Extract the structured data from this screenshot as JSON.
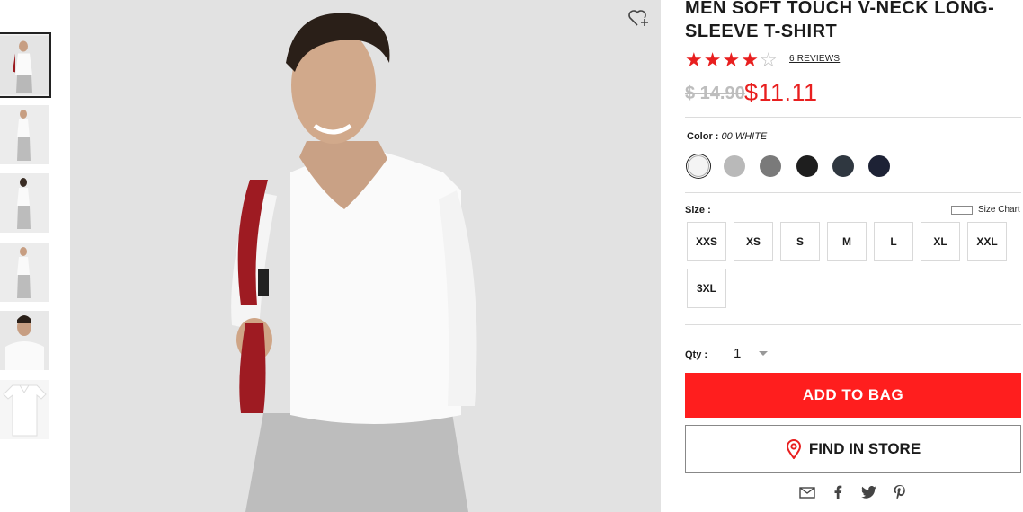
{
  "product": {
    "title": "MEN SOFT TOUCH V-NECK LONG-SLEEVE T-SHIRT",
    "rating": 4,
    "rating_max": 5,
    "reviews_label": "6 REVIEWS",
    "old_price": "$ 14.90",
    "new_price": "$11.11"
  },
  "color": {
    "label": "Color :",
    "selected_name": "00 WHITE",
    "swatches": [
      "#f4f4f4",
      "#b9b9b9",
      "#7a7a7a",
      "#1e1e1e",
      "#2f3740",
      "#1d2235"
    ]
  },
  "size": {
    "label": "Size :",
    "chart_label": "Size Chart",
    "options": [
      "XXS",
      "XS",
      "S",
      "M",
      "L",
      "XL",
      "XXL",
      "3XL"
    ]
  },
  "qty": {
    "label": "Qty :",
    "value": "1"
  },
  "buttons": {
    "add_to_bag": "ADD TO BAG",
    "find_in_store": "FIND IN STORE"
  },
  "share_icons": [
    "email-icon",
    "facebook-icon",
    "twitter-icon",
    "pinterest-icon"
  ],
  "colors": {
    "accent": "#ff1e1e",
    "price_red": "#e81f1f"
  }
}
